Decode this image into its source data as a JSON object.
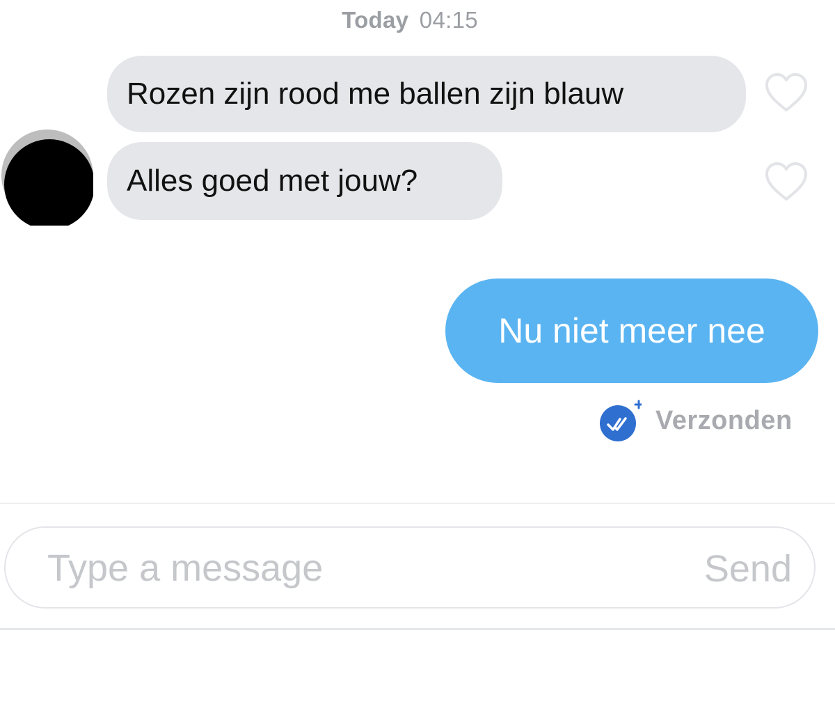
{
  "conversation": {
    "timestamp_day": "Today",
    "timestamp_time": "04:15",
    "received_messages": [
      {
        "text": "Rozen zijn rood me ballen zijn blauw",
        "liked": false
      },
      {
        "text": "Alles goed met jouw?",
        "liked": false
      }
    ],
    "sent_message": {
      "text": "Nu niet meer nee",
      "status": "Verzonden"
    }
  },
  "composer": {
    "placeholder": "Type a message",
    "send_label": "Send"
  },
  "colors": {
    "received_bubble": "#e5e6ea",
    "sent_bubble": "#5ab4f1",
    "status_badge": "#2f6fd0",
    "muted_text": "#a8aaaf"
  },
  "icons": {
    "like": "heart-outline-icon",
    "status": "double-check-badge-icon"
  }
}
